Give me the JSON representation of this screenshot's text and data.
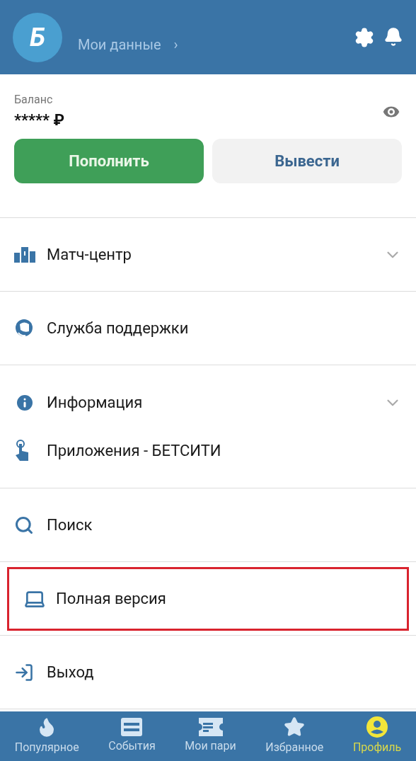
{
  "header": {
    "logo": "Б",
    "profile_link": "Мои данные",
    "chevron": "›"
  },
  "balance": {
    "label": "Баланс",
    "value": "*****",
    "currency": "₽",
    "hidden": true
  },
  "buttons": [
    {
      "label": "Пополнить",
      "kind": "primary"
    },
    {
      "label": "Вывести",
      "kind": "secondary"
    }
  ],
  "menu_groups": [
    {
      "items": [
        {
          "label": "Матч-центр",
          "expanded": false,
          "highlighted": false
        }
      ]
    },
    {
      "items": [
        {
          "label": "Служба поддержки",
          "highlighted": false
        }
      ]
    },
    {
      "items": [
        {
          "label": "Информация",
          "expanded": false,
          "highlighted": false
        },
        {
          "label": "Приложения - БЕТСИТИ",
          "highlighted": false
        }
      ]
    },
    {
      "items": [
        {
          "label": "Поиск",
          "highlighted": false
        }
      ]
    },
    {
      "items": [
        {
          "label": "Полная версия",
          "highlighted": true
        }
      ]
    },
    {
      "items": [
        {
          "label": "Выход",
          "highlighted": false
        }
      ]
    }
  ],
  "bottom_nav": [
    {
      "label": "Популярное",
      "selected": false
    },
    {
      "label": "События",
      "selected": false
    },
    {
      "label": "Мои пари",
      "selected": false
    },
    {
      "label": "Избранное",
      "selected": false
    },
    {
      "label": "Профиль",
      "selected": true
    }
  ]
}
